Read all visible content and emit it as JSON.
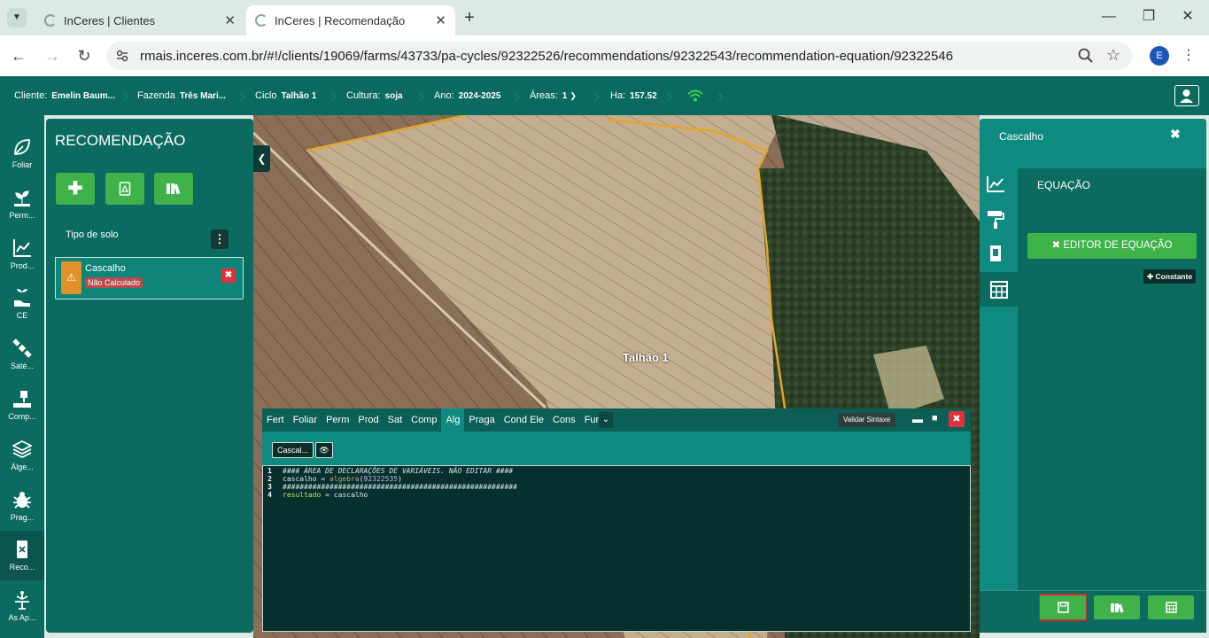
{
  "browser": {
    "tabs": [
      {
        "title": "InCeres | Clientes",
        "active": false
      },
      {
        "title": "InCeres | Recomendação",
        "active": true
      }
    ],
    "url": "rmais.inceres.com.br/#!/clients/19069/farms/43733/pa-cycles/92322526/recommendations/92322543/recommendation-equation/92322546",
    "profile_initial": "E"
  },
  "header": {
    "client_key": "Cliente:",
    "client_val": "Emelin Baum...",
    "farm_key": "Fazenda",
    "farm_val": "Três Mari...",
    "cycle_key": "Ciclo",
    "cycle_val": "Talhão 1",
    "crop_key": "Cultura:",
    "crop_val": "soja",
    "year_key": "Ano:",
    "year_val": "2024-2025",
    "areas_key": "Áreas:",
    "areas_val": "1",
    "ha_key": "Ha:",
    "ha_val": "157.52"
  },
  "leftnav": [
    {
      "label": "Foliar",
      "icon": "leaf-icon"
    },
    {
      "label": "Perm...",
      "icon": "sprout-icon"
    },
    {
      "label": "Prod...",
      "icon": "line-chart-icon"
    },
    {
      "label": "CE",
      "icon": "plant-hand-icon"
    },
    {
      "label": "Saté...",
      "icon": "satellite-icon"
    },
    {
      "label": "Comp...",
      "icon": "compaction-icon"
    },
    {
      "label": "Álge...",
      "icon": "layers-icon"
    },
    {
      "label": "Prag...",
      "icon": "bug-icon"
    },
    {
      "label": "Reco...",
      "icon": "recommendation-icon",
      "active": true
    },
    {
      "label": "As Ap...",
      "icon": "sprayer-icon"
    }
  ],
  "recommendation": {
    "title": "RECOMENDAÇÃO",
    "card_header": "Tipo de solo",
    "item_name": "Cascalho",
    "item_status": "Não Calculado"
  },
  "map": {
    "field_label": "Talhão 1"
  },
  "editor": {
    "tabs": [
      "Fert",
      "Foliar",
      "Perm",
      "Prod",
      "Sat",
      "Comp",
      "Alg",
      "Praga",
      "Cond Ele",
      "Cons",
      "Func"
    ],
    "active_tab": "Alg",
    "validate_label": "Validar Sintaxe",
    "var_button": "Cascal...",
    "code": [
      {
        "n": "1",
        "parts": [
          {
            "t": "#### ÁREA DE DECLARAÇÕES DE VARIÁVEIS. NÃO EDITAR ####",
            "c": "cm"
          }
        ]
      },
      {
        "n": "2",
        "parts": [
          {
            "t": "cascalho = ",
            "c": ""
          },
          {
            "t": "algebra",
            "c": "fn"
          },
          {
            "t": "(",
            "c": ""
          },
          {
            "t": "92322535",
            "c": "nm"
          },
          {
            "t": ")",
            "c": ""
          }
        ]
      },
      {
        "n": "3",
        "parts": [
          {
            "t": "#######################################################",
            "c": "cm"
          }
        ]
      },
      {
        "n": "4",
        "parts": [
          {
            "t": "resultado",
            "c": "vr"
          },
          {
            "t": " = cascalho",
            "c": ""
          }
        ]
      }
    ]
  },
  "rightpanel": {
    "title": "Cascalho",
    "section": "EQUAÇÃO",
    "editor_button": "✖ EDITOR DE EQUAÇÃO",
    "constant_button": "✚ Constante"
  },
  "colors": {
    "primary": "#0b6b60",
    "accent": "#0f8a80",
    "success": "#3fb24a",
    "danger": "#e0303c",
    "warning": "#e2902a"
  }
}
